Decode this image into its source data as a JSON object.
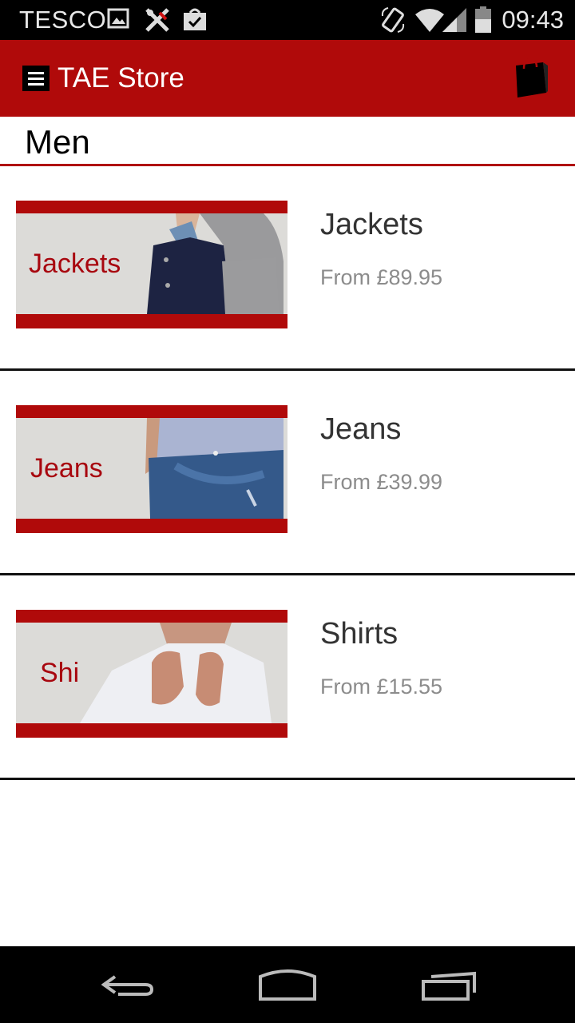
{
  "status_bar": {
    "carrier": "TESCO",
    "time": "09:43",
    "icons": [
      "image-icon",
      "tools-icon",
      "check-bag-icon",
      "rotate-icon",
      "wifi-icon",
      "signal-icon",
      "battery-icon"
    ]
  },
  "app_bar": {
    "title": "TAE Store",
    "menu_icon": "menu-icon",
    "cart_icon": "shopping-bag-icon"
  },
  "section": {
    "title": "Men"
  },
  "categories": [
    {
      "name": "Jackets",
      "price": "From £89.95",
      "thumb_label": "Jackets"
    },
    {
      "name": "Jeans",
      "price": "From £39.99",
      "thumb_label": "Jeans"
    },
    {
      "name": "Shirts",
      "price": "From £15.55",
      "thumb_label": "Shirts"
    }
  ],
  "nav_bar": {
    "icons": [
      "back-icon",
      "home-icon",
      "recents-icon"
    ]
  },
  "colors": {
    "brand_red": "#b00a0a",
    "thumb_bg": "#dcdbd8",
    "text_dark": "#333333",
    "text_muted": "#8c8c8c"
  }
}
